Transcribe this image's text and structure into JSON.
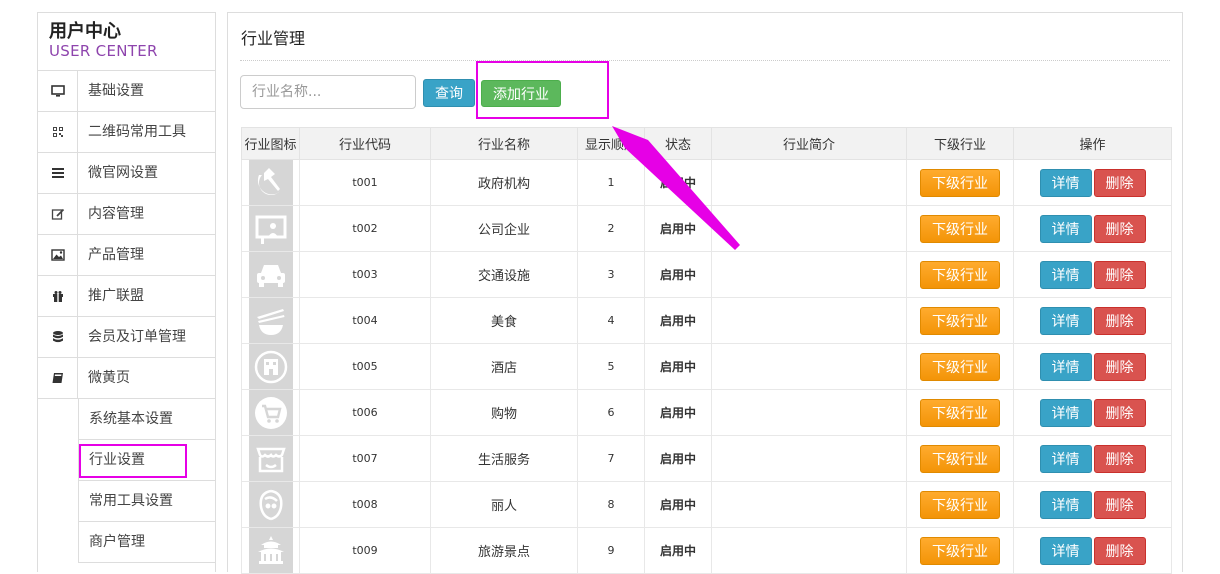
{
  "brand": {
    "title_cn": "用户中心",
    "title_en": "USER CENTER"
  },
  "sidebar": {
    "items": [
      {
        "label": "基础设置",
        "icon": "monitor-icon"
      },
      {
        "label": "二维码常用工具",
        "icon": "qrcode-icon"
      },
      {
        "label": "微官网设置",
        "icon": "list-icon"
      },
      {
        "label": "内容管理",
        "icon": "edit-icon"
      },
      {
        "label": "产品管理",
        "icon": "image-icon"
      },
      {
        "label": "推广联盟",
        "icon": "gift-icon"
      },
      {
        "label": "会员及订单管理",
        "icon": "database-icon"
      },
      {
        "label": "微黄页",
        "icon": "book-icon"
      }
    ],
    "subitems": [
      {
        "label": "系统基本设置"
      },
      {
        "label": "行业设置",
        "active": true
      },
      {
        "label": "常用工具设置"
      },
      {
        "label": "商户管理"
      }
    ]
  },
  "main": {
    "title": "行业管理",
    "search": {
      "placeholder": "行业名称..."
    },
    "query_label": "查询",
    "add_label": "添加行业"
  },
  "table": {
    "headers": [
      "行业图标",
      "行业代码",
      "行业名称",
      "显示顺序",
      "状态",
      "行业简介",
      "下级行业",
      "操作"
    ],
    "rows": [
      {
        "icon": "hammer-sickle-icon",
        "code": "t001",
        "name": "政府机构",
        "order": "1",
        "status": "启用中",
        "intro": "",
        "sub": "下级行业",
        "detail": "详情",
        "del": "删除"
      },
      {
        "icon": "presentation-board-icon",
        "code": "t002",
        "name": "公司企业",
        "order": "2",
        "status": "启用中",
        "intro": "",
        "sub": "下级行业",
        "detail": "详情",
        "del": "删除"
      },
      {
        "icon": "car-icon",
        "code": "t003",
        "name": "交通设施",
        "order": "3",
        "status": "启用中",
        "intro": "",
        "sub": "下级行业",
        "detail": "详情",
        "del": "删除"
      },
      {
        "icon": "bowl-chopsticks-icon",
        "code": "t004",
        "name": "美食",
        "order": "4",
        "status": "启用中",
        "intro": "",
        "sub": "下级行业",
        "detail": "详情",
        "del": "删除"
      },
      {
        "icon": "hotel-building-icon",
        "code": "t005",
        "name": "酒店",
        "order": "5",
        "status": "启用中",
        "intro": "",
        "sub": "下级行业",
        "detail": "详情",
        "del": "删除"
      },
      {
        "icon": "shopping-cart-icon",
        "code": "t006",
        "name": "购物",
        "order": "6",
        "status": "启用中",
        "intro": "",
        "sub": "下级行业",
        "detail": "详情",
        "del": "删除"
      },
      {
        "icon": "storefront-icon",
        "code": "t007",
        "name": "生活服务",
        "order": "7",
        "status": "启用中",
        "intro": "",
        "sub": "下级行业",
        "detail": "详情",
        "del": "删除"
      },
      {
        "icon": "woman-face-icon",
        "code": "t008",
        "name": "丽人",
        "order": "8",
        "status": "启用中",
        "intro": "",
        "sub": "下级行业",
        "detail": "详情",
        "del": "删除"
      },
      {
        "icon": "pagoda-icon",
        "code": "t009",
        "name": "旅游景点",
        "order": "9",
        "status": "启用中",
        "intro": "",
        "sub": "下级行业",
        "detail": "详情",
        "del": "删除"
      }
    ]
  },
  "colors": {
    "highlight": "#e600e6",
    "brand_en": "#8e44ad",
    "btn_query": "#39a3c7",
    "btn_add": "#5cb85c",
    "btn_sub": "#f39407",
    "btn_del": "#d9534f",
    "status": "#1c8a1c"
  }
}
